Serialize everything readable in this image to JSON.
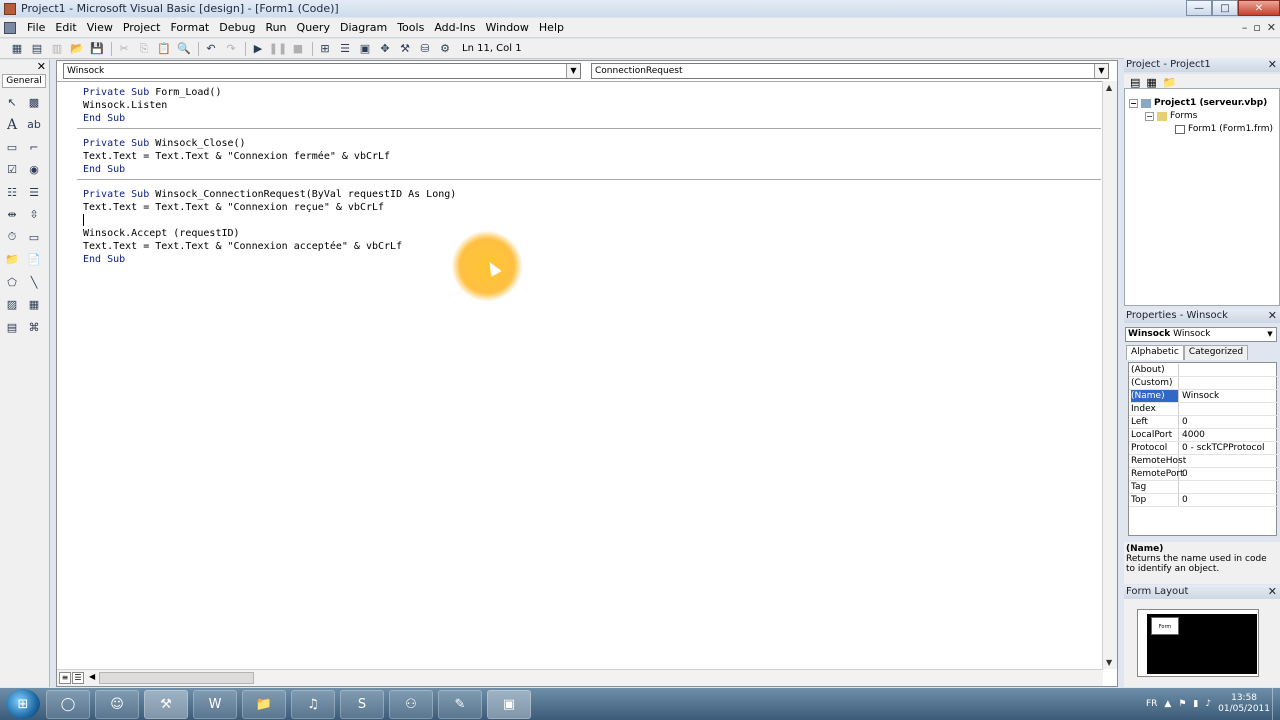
{
  "window": {
    "title": "Project1 - Microsoft Visual Basic [design] - [Form1 (Code)]",
    "buttons": {
      "minimize": "—",
      "maximize": "□",
      "close": "✕"
    }
  },
  "menu": {
    "items": [
      "File",
      "Edit",
      "View",
      "Project",
      "Format",
      "Debug",
      "Run",
      "Query",
      "Diagram",
      "Tools",
      "Add-Ins",
      "Window",
      "Help"
    ],
    "mdi_buttons": {
      "minimize": "–",
      "restore": "▫",
      "close": "✕"
    }
  },
  "toolbar": {
    "position": "Ln 11, Col 1",
    "icons": [
      "add-project-icon",
      "add-form-icon",
      "menu-editor-icon",
      "open-icon",
      "save-icon",
      "cut-icon",
      "copy-icon",
      "paste-icon",
      "find-icon",
      "undo-icon",
      "redo-icon",
      "start-icon",
      "break-icon",
      "end-icon",
      "project-explorer-icon",
      "properties-icon",
      "form-layout-icon",
      "object-browser-icon",
      "toolbox-icon",
      "data-view-icon",
      "component-manager-icon"
    ]
  },
  "toolbox": {
    "tab_label": "General",
    "close": "✕"
  },
  "code_window": {
    "object_combo": "Winsock",
    "procedure_combo": "ConnectionRequest",
    "lines": [
      {
        "kw": "Private Sub ",
        "rest": "Form_Load()"
      },
      {
        "kw": "",
        "rest": "Winsock.Listen"
      },
      {
        "kw": "End Sub",
        "rest": ""
      },
      {
        "kw": "Private Sub ",
        "rest": "Winsock_Close()"
      },
      {
        "kw": "",
        "rest": "Text.Text = Text.Text & \"Connexion fermée\" & vbCrLf"
      },
      {
        "kw": "End Sub",
        "rest": ""
      },
      {
        "kw": "Private Sub ",
        "rest": "Winsock_ConnectionRequest(ByVal requestID As Long)"
      },
      {
        "kw": "",
        "rest": "Text.Text = Text.Text & \"Connexion reçue\" & vbCrLf"
      },
      {
        "kw": "",
        "rest": ""
      },
      {
        "kw": "",
        "rest": "Winsock.Accept (requestID)"
      },
      {
        "kw": "",
        "rest": "Text.Text = Text.Text & \"Connexion acceptée\" & vbCrLf"
      },
      {
        "kw": "End Sub",
        "rest": ""
      }
    ]
  },
  "project_explorer": {
    "title": "Project - Project1",
    "close": "✕",
    "root": "Project1 (serveur.vbp)",
    "folder": "Forms",
    "item": "Form1 (Form1.frm)"
  },
  "properties": {
    "title": "Properties - Winsock",
    "close": "✕",
    "object_name": "Winsock",
    "object_type": "Winsock",
    "tabs": [
      "Alphabetic",
      "Categorized"
    ],
    "rows": [
      {
        "name": "(About)",
        "value": ""
      },
      {
        "name": "(Custom)",
        "value": ""
      },
      {
        "name": "(Name)",
        "value": "Winsock"
      },
      {
        "name": "Index",
        "value": ""
      },
      {
        "name": "Left",
        "value": "0"
      },
      {
        "name": "LocalPort",
        "value": "4000"
      },
      {
        "name": "Protocol",
        "value": "0 - sckTCPProtocol"
      },
      {
        "name": "RemoteHost",
        "value": ""
      },
      {
        "name": "RemotePort",
        "value": "0"
      },
      {
        "name": "Tag",
        "value": ""
      },
      {
        "name": "Top",
        "value": "0"
      }
    ],
    "desc_title": "(Name)",
    "desc_text": "Returns the name used in code to identify an object."
  },
  "form_layout": {
    "title": "Form Layout",
    "close": "✕",
    "form_label": "Form"
  },
  "taskbar": {
    "language": "FR",
    "time": "13:58",
    "date": "01/05/2011"
  },
  "colors": {
    "keyword": "#0a1f88",
    "selection": "#3168c6",
    "highlight": "#ffb014"
  }
}
